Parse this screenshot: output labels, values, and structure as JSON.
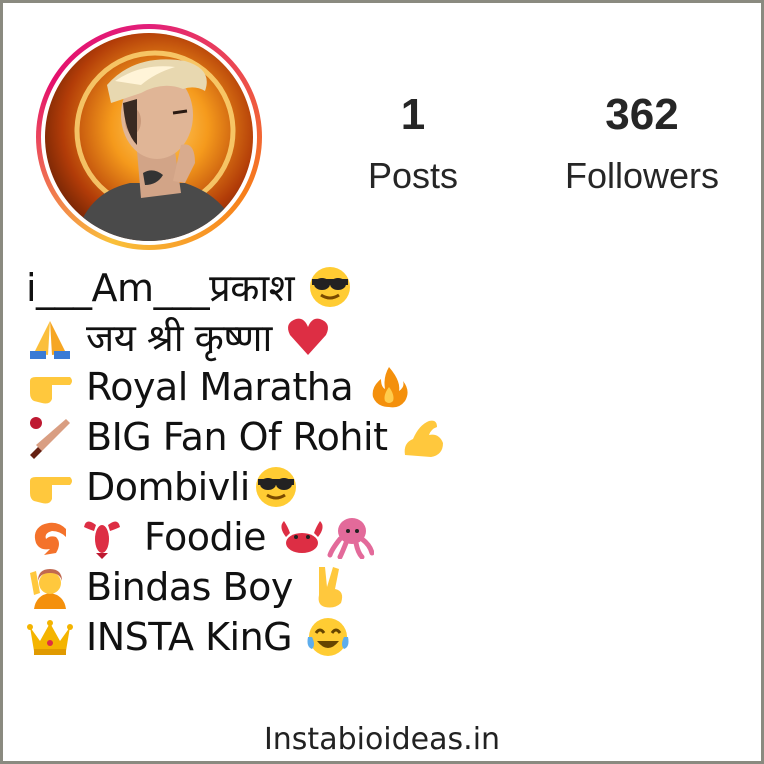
{
  "profile": {
    "stats": {
      "posts_count": "1",
      "posts_label": "Posts",
      "followers_count": "362",
      "followers_label": "Followers"
    },
    "bio_lines": [
      {
        "text": "i___Am___प्रकाश",
        "icons": [
          "sunglasses-face-icon"
        ]
      },
      {
        "text": "जय श्री कृष्णा",
        "icons": [
          "folded-hands-icon",
          "red-heart-icon"
        ]
      },
      {
        "text": "Royal Maratha",
        "icons": [
          "pointing-right-icon",
          "fire-icon"
        ]
      },
      {
        "text": "BIG Fan Of Rohit",
        "icons": [
          "cricket-bat-icon",
          "flexed-biceps-icon"
        ]
      },
      {
        "text": "Dombivli",
        "icons": [
          "pointing-right-icon",
          "sunglasses-face-icon"
        ]
      },
      {
        "text": "Foodie",
        "icons": [
          "shrimp-icon",
          "lobster-icon",
          "crab-icon",
          "octopus-icon"
        ]
      },
      {
        "text": "Bindas Boy",
        "icons": [
          "person-raising-hand-icon",
          "victory-hand-icon"
        ]
      },
      {
        "text": "INSTA KinG",
        "icons": [
          "crown-icon",
          "tears-of-joy-face-icon"
        ]
      }
    ]
  },
  "footer": {
    "watermark": "Instabioideas.in"
  },
  "colors": {
    "frame": "#8a8a80",
    "ring_start": "#e21f7a",
    "ring_mid": "#f9c03a",
    "text": "#262626"
  }
}
